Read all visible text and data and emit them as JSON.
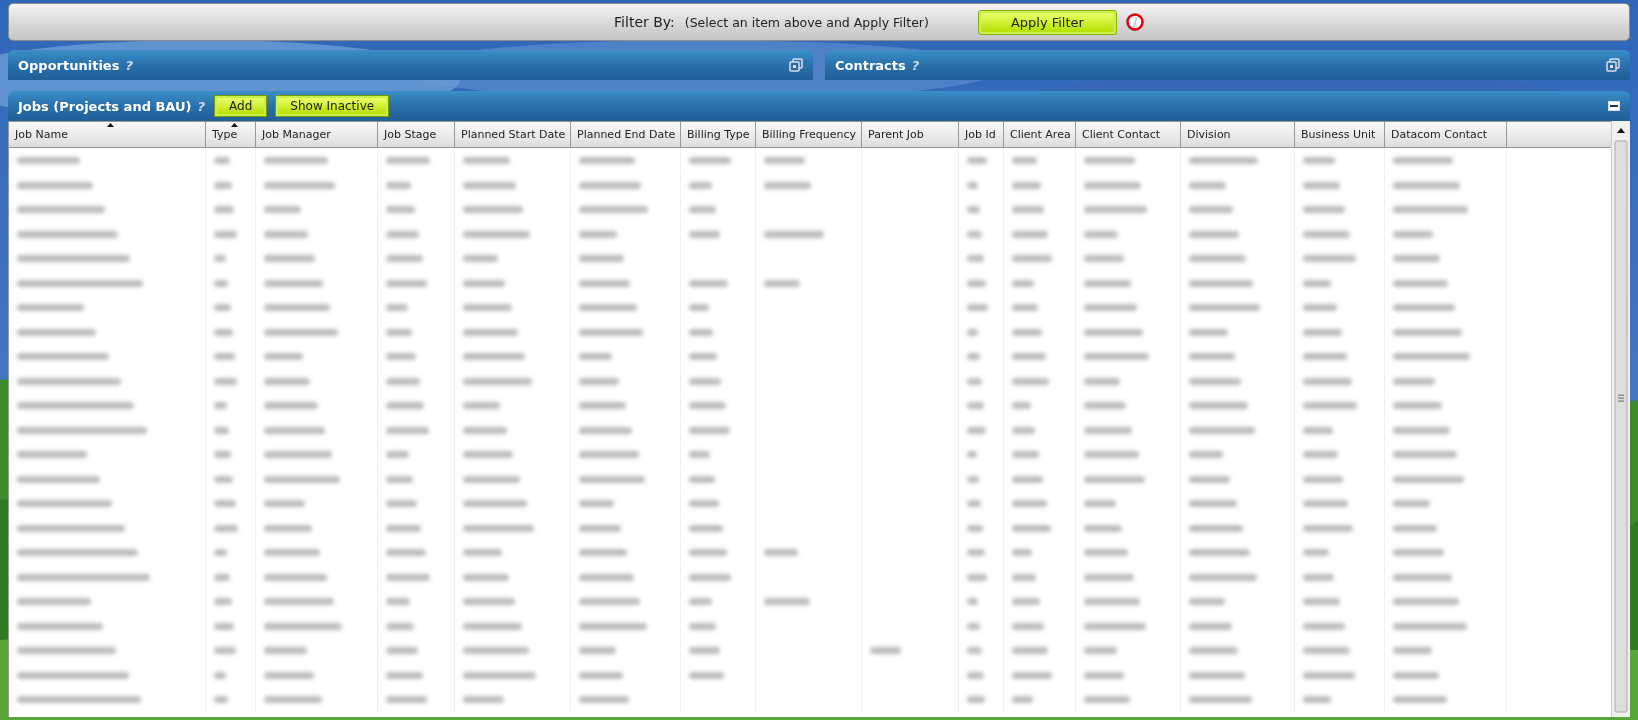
{
  "filter_bar": {
    "label": "Filter By:",
    "hint": "(Select an item above and Apply Filter)",
    "apply_button": "Apply Filter"
  },
  "panels": [
    {
      "title": "Opportunities",
      "help": "?"
    },
    {
      "title": "Contracts",
      "help": "?"
    }
  ],
  "jobs": {
    "title": "Jobs (Projects and BAU)",
    "help": "?",
    "buttons": [
      "Add",
      "Show Inactive"
    ],
    "table": {
      "columns": [
        {
          "label": "Job Name",
          "sorted": true
        },
        {
          "label": "Type",
          "sorted": true
        },
        {
          "label": "Job Manager",
          "sorted": false
        },
        {
          "label": "Job Stage",
          "sorted": false
        },
        {
          "label": "Planned Start Date",
          "sorted": false
        },
        {
          "label": "Planned End Date",
          "sorted": false
        },
        {
          "label": "Billing Type",
          "sorted": false
        },
        {
          "label": "Billing Frequency",
          "sorted": false
        },
        {
          "label": "Parent Job",
          "sorted": false
        },
        {
          "label": "Job Id",
          "sorted": false
        },
        {
          "label": "Client Area",
          "sorted": false
        },
        {
          "label": "Client Contact",
          "sorted": false
        },
        {
          "label": "Division",
          "sorted": false
        },
        {
          "label": "Business Unit",
          "sorted": false
        },
        {
          "label": "Datacom Contact",
          "sorted": false
        }
      ],
      "rows": [
        {
          "blurred": [
            true,
            true,
            true,
            true,
            true,
            true,
            true,
            true,
            false,
            true,
            true,
            true,
            true,
            true,
            true
          ]
        },
        {
          "blurred": [
            true,
            true,
            true,
            true,
            true,
            true,
            true,
            true,
            false,
            true,
            true,
            true,
            true,
            true,
            true
          ]
        },
        {
          "blurred": [
            true,
            true,
            true,
            true,
            true,
            true,
            true,
            false,
            false,
            true,
            true,
            true,
            true,
            true,
            true
          ]
        },
        {
          "blurred": [
            true,
            true,
            true,
            true,
            true,
            true,
            true,
            true,
            false,
            true,
            true,
            true,
            true,
            true,
            true
          ]
        },
        {
          "blurred": [
            true,
            true,
            true,
            true,
            true,
            true,
            false,
            false,
            false,
            true,
            true,
            true,
            true,
            true,
            true
          ]
        },
        {
          "blurred": [
            true,
            true,
            true,
            true,
            true,
            true,
            true,
            true,
            false,
            true,
            true,
            true,
            true,
            true,
            true
          ]
        },
        {
          "blurred": [
            true,
            true,
            true,
            true,
            true,
            true,
            true,
            false,
            false,
            true,
            true,
            true,
            true,
            true,
            true
          ]
        },
        {
          "blurred": [
            true,
            true,
            true,
            true,
            true,
            true,
            true,
            false,
            false,
            true,
            true,
            true,
            true,
            true,
            true
          ]
        },
        {
          "blurred": [
            true,
            true,
            true,
            true,
            true,
            true,
            true,
            false,
            false,
            true,
            true,
            true,
            true,
            true,
            true
          ]
        },
        {
          "blurred": [
            true,
            true,
            true,
            true,
            true,
            true,
            true,
            false,
            false,
            true,
            true,
            true,
            true,
            true,
            true
          ]
        },
        {
          "blurred": [
            true,
            true,
            true,
            true,
            true,
            true,
            true,
            false,
            false,
            true,
            true,
            true,
            true,
            true,
            true
          ]
        },
        {
          "blurred": [
            true,
            true,
            true,
            true,
            true,
            true,
            true,
            false,
            false,
            true,
            true,
            true,
            true,
            true,
            true
          ]
        },
        {
          "blurred": [
            true,
            true,
            true,
            true,
            true,
            true,
            true,
            false,
            false,
            true,
            true,
            true,
            true,
            true,
            true
          ]
        },
        {
          "blurred": [
            true,
            true,
            true,
            true,
            true,
            true,
            true,
            false,
            false,
            true,
            true,
            true,
            true,
            true,
            true
          ]
        },
        {
          "blurred": [
            true,
            true,
            true,
            true,
            true,
            true,
            true,
            false,
            false,
            true,
            true,
            true,
            true,
            true,
            true
          ]
        },
        {
          "blurred": [
            true,
            true,
            true,
            true,
            true,
            true,
            true,
            false,
            false,
            true,
            true,
            true,
            true,
            true,
            true
          ]
        },
        {
          "blurred": [
            true,
            true,
            true,
            true,
            true,
            true,
            true,
            true,
            false,
            true,
            true,
            true,
            true,
            true,
            true
          ]
        },
        {
          "blurred": [
            true,
            true,
            true,
            true,
            true,
            true,
            true,
            false,
            false,
            true,
            true,
            true,
            true,
            true,
            true
          ]
        },
        {
          "blurred": [
            true,
            true,
            true,
            true,
            true,
            true,
            true,
            true,
            false,
            true,
            true,
            true,
            true,
            true,
            true
          ]
        },
        {
          "blurred": [
            true,
            true,
            true,
            true,
            true,
            true,
            true,
            false,
            false,
            true,
            true,
            true,
            true,
            true,
            true
          ]
        },
        {
          "blurred": [
            true,
            true,
            true,
            true,
            true,
            true,
            true,
            false,
            true,
            true,
            true,
            true,
            true,
            true,
            true
          ]
        },
        {
          "blurred": [
            true,
            true,
            true,
            true,
            true,
            true,
            true,
            false,
            false,
            true,
            true,
            true,
            true,
            true,
            true
          ]
        },
        {
          "blurred": [
            true,
            true,
            true,
            true,
            true,
            true,
            false,
            false,
            false,
            true,
            true,
            true,
            true,
            true,
            true
          ]
        }
      ]
    }
  }
}
